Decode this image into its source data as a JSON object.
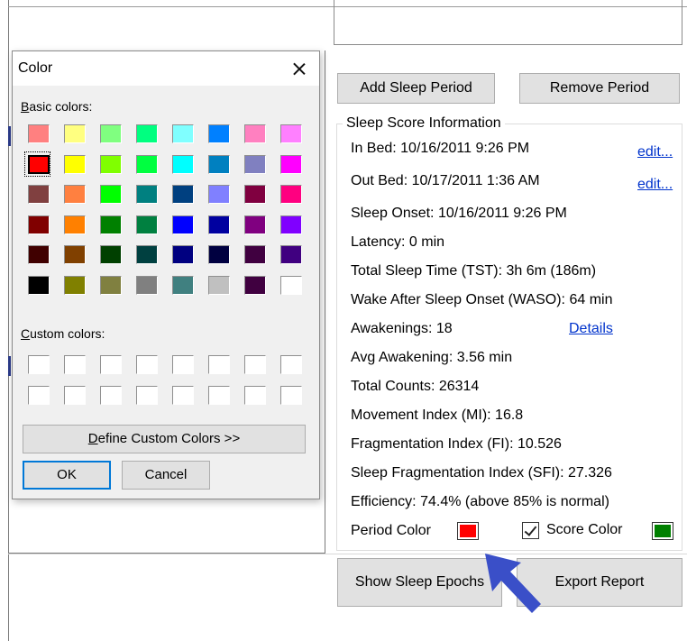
{
  "dialog": {
    "title": "Color",
    "basic_colors_label_u": "B",
    "basic_colors_label_rest": "asic colors:",
    "custom_colors_label_u": "C",
    "custom_colors_label_rest": "ustom colors:",
    "define_custom_u": "D",
    "define_custom_rest": "efine Custom Colors >>",
    "ok_label": "OK",
    "cancel_label": "Cancel",
    "basic_colors": [
      [
        "#ff8080",
        "#ffff80",
        "#80ff80",
        "#00ff80",
        "#80ffff",
        "#0080ff",
        "#ff80c0",
        "#ff80ff"
      ],
      [
        "#ff0000",
        "#ffff00",
        "#80ff00",
        "#00ff40",
        "#00ffff",
        "#0080c0",
        "#8080c0",
        "#ff00ff"
      ],
      [
        "#804040",
        "#ff8040",
        "#00ff00",
        "#008080",
        "#004080",
        "#8080ff",
        "#800040",
        "#ff0080"
      ],
      [
        "#800000",
        "#ff8000",
        "#008000",
        "#008040",
        "#0000ff",
        "#0000a0",
        "#800080",
        "#8000ff"
      ],
      [
        "#400000",
        "#804000",
        "#004000",
        "#004040",
        "#000080",
        "#000040",
        "#400040",
        "#400080"
      ],
      [
        "#000000",
        "#808000",
        "#808040",
        "#808080",
        "#408080",
        "#c0c0c0",
        "#400040",
        "#ffffff"
      ]
    ],
    "selected_color": "#ff0000"
  },
  "panel": {
    "add_sleep_period": "Add Sleep Period",
    "remove_period": "Remove Period",
    "group_title": "Sleep Score Information",
    "in_bed": "In Bed:  10/16/2011 9:26 PM",
    "out_bed": "Out Bed:  10/17/2011 1:36 AM",
    "edit_label": "edit...",
    "sleep_onset": "Sleep Onset: 10/16/2011 9:26 PM",
    "latency": "Latency: 0 min",
    "tst": "Total Sleep Time (TST): 3h 6m (186m)",
    "waso": "Wake After Sleep Onset (WASO): 64 min",
    "awakenings": "Awakenings: 18",
    "details_label": "Details",
    "avg_awakening": "Avg Awakening: 3.56 min",
    "total_counts": "Total Counts: 26314",
    "movement_index": "Movement Index (MI): 16.8",
    "fragmentation_index": "Fragmentation Index (FI): 10.526",
    "sfi": "Sleep Fragmentation Index (SFI): 27.326",
    "efficiency": "Efficiency: 74.4% (above 85% is normal)",
    "period_color_label": "Period Color",
    "period_color": "#ff0000",
    "score_color_label": "Score Color",
    "score_color_checked": true,
    "score_color": "#008000",
    "show_sleep_epochs": "Show Sleep Epochs",
    "export_report": "Export Report"
  },
  "annotation": {
    "arrow_icon": "pointer-arrow-icon",
    "arrow_color": "#3a4fc8"
  }
}
